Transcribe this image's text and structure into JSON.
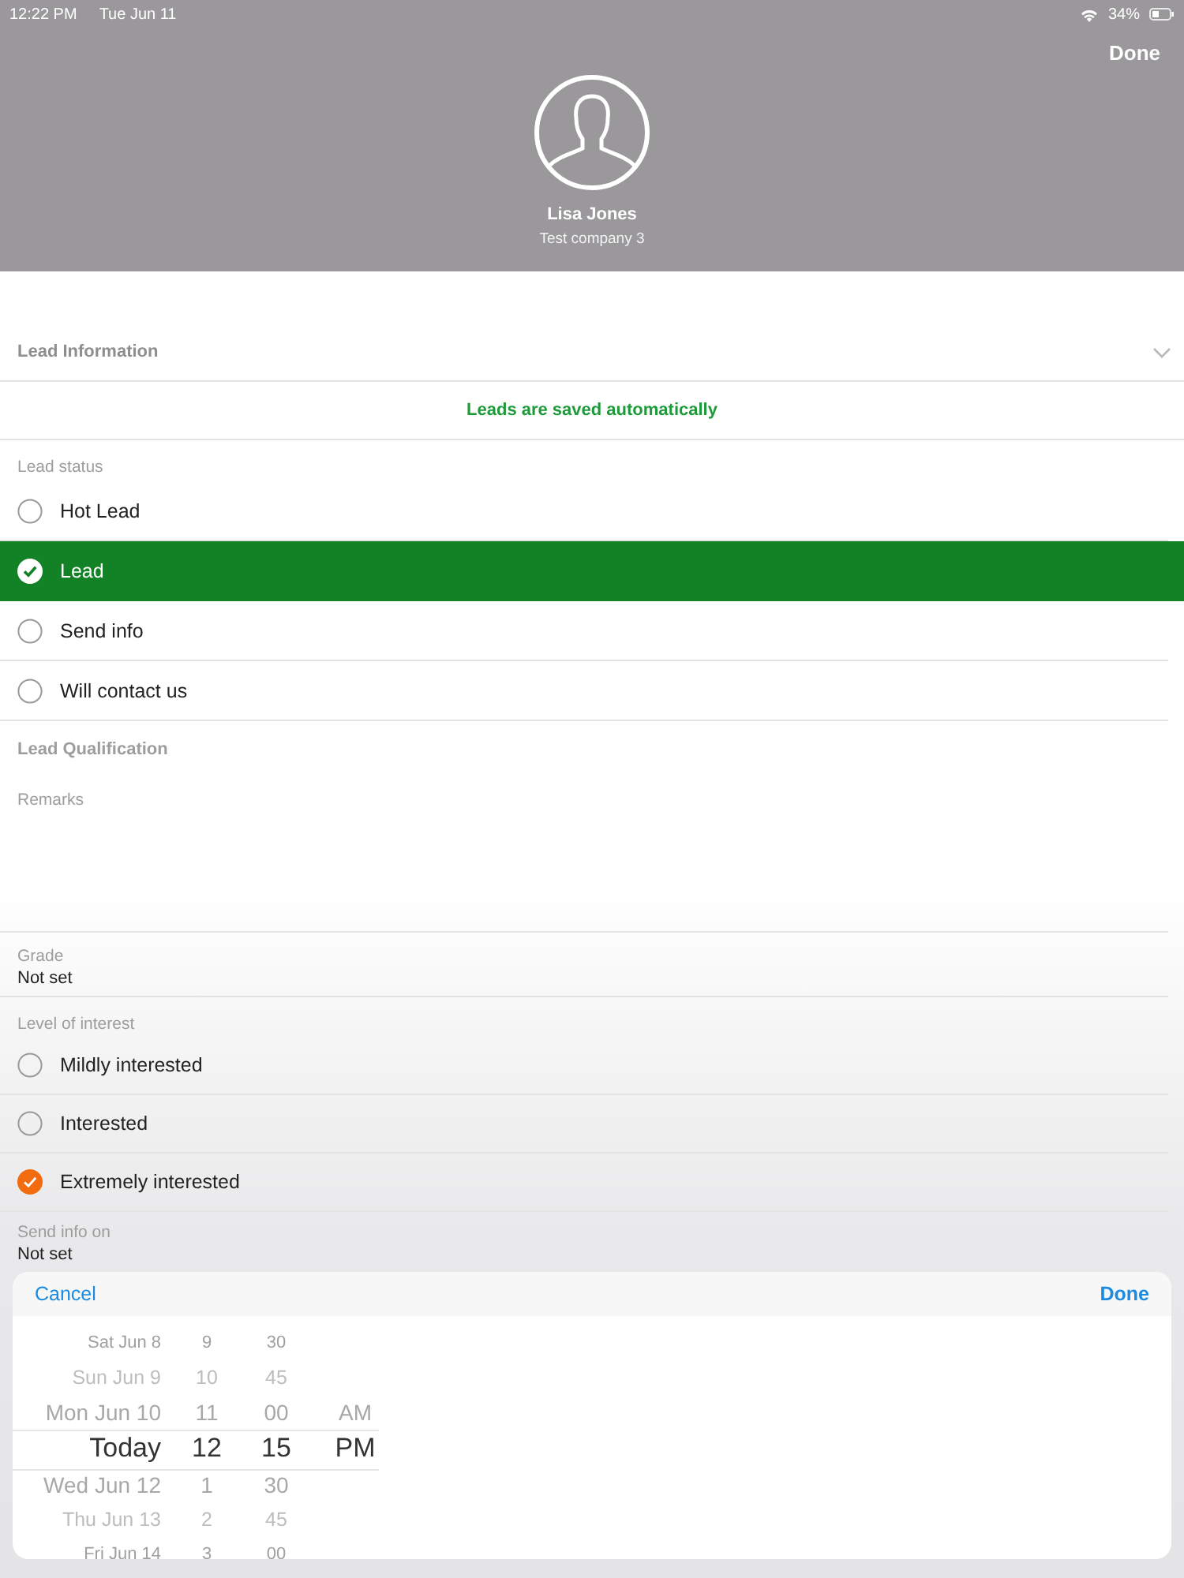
{
  "status_bar": {
    "time": "12:22 PM",
    "date": "Tue Jun 11",
    "battery": "34%"
  },
  "header": {
    "done": "Done",
    "name": "Lisa Jones",
    "company": "Test company 3"
  },
  "section": {
    "title": "Lead Information"
  },
  "notice": "Leads are saved automatically",
  "lead_status": {
    "label": "Lead status",
    "options": [
      {
        "label": "Hot Lead",
        "selected": false
      },
      {
        "label": "Lead",
        "selected": true
      },
      {
        "label": "Send info",
        "selected": false
      },
      {
        "label": "Will contact us",
        "selected": false
      }
    ]
  },
  "qualification_title": "Lead Qualification",
  "remarks": {
    "label": "Remarks"
  },
  "grade": {
    "label": "Grade",
    "value": "Not set"
  },
  "interest": {
    "label": "Level of interest",
    "options": [
      {
        "label": "Mildly interested",
        "selected": false
      },
      {
        "label": "Interested",
        "selected": false
      },
      {
        "label": "Extremely interested",
        "selected": true
      }
    ]
  },
  "send_info": {
    "label": "Send info on",
    "value": "Not set"
  },
  "picker": {
    "cancel": "Cancel",
    "done": "Done",
    "columns": [
      {
        "kind": "date",
        "items": [
          {
            "text": "Sat Jun 8",
            "selected": false
          },
          {
            "text": "Sun Jun 9",
            "selected": false
          },
          {
            "text": "Mon Jun 10",
            "selected": false
          },
          {
            "text": "Today",
            "selected": true
          },
          {
            "text": "Wed Jun 12",
            "selected": false
          },
          {
            "text": "Thu Jun 13",
            "selected": false
          },
          {
            "text": "Fri Jun 14",
            "selected": false
          }
        ]
      },
      {
        "kind": "hour",
        "items": [
          {
            "text": "9",
            "selected": false
          },
          {
            "text": "10",
            "selected": false
          },
          {
            "text": "11",
            "selected": false
          },
          {
            "text": "12",
            "selected": true
          },
          {
            "text": "1",
            "selected": false
          },
          {
            "text": "2",
            "selected": false
          },
          {
            "text": "3",
            "selected": false
          }
        ]
      },
      {
        "kind": "minute",
        "items": [
          {
            "text": "30",
            "selected": false
          },
          {
            "text": "45",
            "selected": false
          },
          {
            "text": "00",
            "selected": false
          },
          {
            "text": "15",
            "selected": true
          },
          {
            "text": "30",
            "selected": false
          },
          {
            "text": "45",
            "selected": false
          },
          {
            "text": "00",
            "selected": false
          }
        ]
      },
      {
        "kind": "ampm",
        "items": [
          {
            "text": "AM",
            "selected": false
          },
          {
            "text": "PM",
            "selected": true
          }
        ]
      }
    ]
  }
}
